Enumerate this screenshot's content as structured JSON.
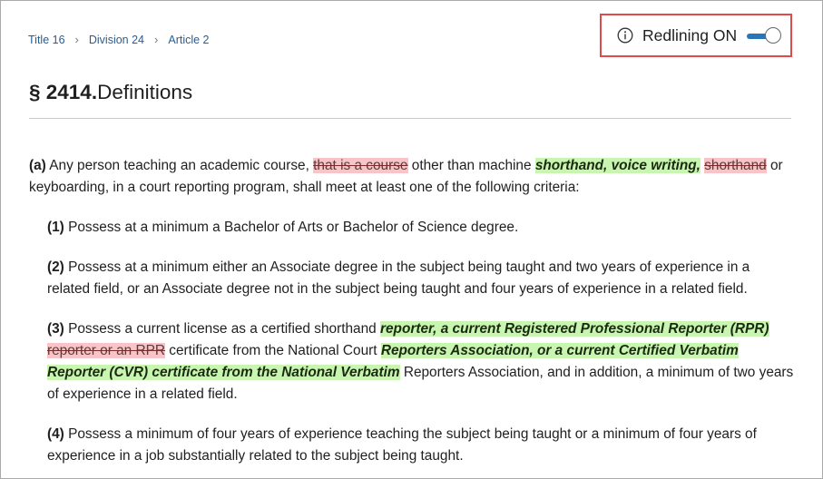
{
  "breadcrumb": [
    {
      "label": "Title 16"
    },
    {
      "label": "Division 24"
    },
    {
      "label": "Article 2"
    }
  ],
  "redlining": {
    "label": "Redlining ON",
    "enabled": true,
    "info_icon": "info-circle-icon"
  },
  "section": {
    "number": "§ 2414.",
    "title": "Definitions"
  },
  "paragraphs": {
    "a": {
      "marker": "(a)",
      "t1": " Any person teaching an academic course, ",
      "del1": "that is a course",
      "t2": " other than machine ",
      "ins1": "shorthand, voice writing,",
      "t3": " ",
      "del2": "shorthand",
      "t4": " or keyboarding, in a court reporting program, shall meet at least one of the following criteria:"
    },
    "p1": {
      "marker": "(1)",
      "text": " Possess at a minimum a Bachelor of Arts or Bachelor of Science degree."
    },
    "p2": {
      "marker": "(2)",
      "text": " Possess at a minimum either an Associate degree in the subject being taught and two years of experience in a related field, or an Associate degree not in the subject being taught and four years of experience in a related field."
    },
    "p3": {
      "marker": "(3)",
      "t1": " Possess a current license as a certified shorthand ",
      "ins1": "reporter, a current Registered Professional Reporter (RPR)",
      "t2": " ",
      "del1": "reporter or an RPR",
      "t3": " certificate from the National Court ",
      "ins2": "Reporters Association, or a current Certified Verbatim Reporter (CVR) certificate from the National Verbatim",
      "t4": " Reporters Association, and in addition, a minimum of two years of experience in a related field."
    },
    "p4": {
      "marker": "(4)",
      "text": " Possess a minimum of four years of experience teaching the subject being taught or a minimum of four years of experience in a job substantially related to the subject being taught."
    }
  },
  "colors": {
    "deleted_bg": "#f9c4c8",
    "inserted_bg": "#c8f5b0",
    "link": "#2a5d8f",
    "toggle": "#2a74b8",
    "highlight_box": "#e04a4a"
  }
}
